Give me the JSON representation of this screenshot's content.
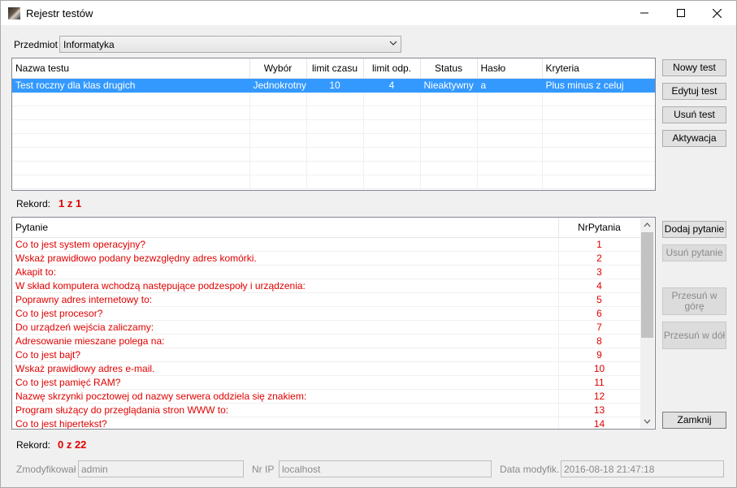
{
  "window": {
    "title": "Rejestr testów"
  },
  "subject": {
    "label": "Przedmiot",
    "value": "Informatyka"
  },
  "tests": {
    "headers": [
      "Nazwa testu",
      "Wybór",
      "limit czasu",
      "limit odp.",
      "Status",
      "Hasło",
      "Kryteria"
    ],
    "rows": [
      [
        "Test roczny dla klas drugich",
        "Jednokrotny",
        "10",
        "4",
        "Nieaktywny",
        "a",
        "Plus minus z celuj"
      ]
    ]
  },
  "test_buttons": {
    "new": "Nowy test",
    "edit": "Edytuj test",
    "delete": "Usuń test",
    "activate": "Aktywacja"
  },
  "record_tests": {
    "label": "Rekord:",
    "value": "1 z 1"
  },
  "questions": {
    "headers": [
      "Pytanie",
      "NrPytania"
    ],
    "rows": [
      [
        "Co to jest system operacyjny?",
        "1"
      ],
      [
        "Wskaż prawidłowo podany bezwzględny adres komórki.",
        "2"
      ],
      [
        "Akapit to:",
        "3"
      ],
      [
        "W skład komputera wchodzą następujące podzespoły i urządzenia:",
        "4"
      ],
      [
        "Poprawny adres internetowy to:",
        "5"
      ],
      [
        "Co to jest procesor?",
        "6"
      ],
      [
        "Do urządzeń wejścia zaliczamy:",
        "7"
      ],
      [
        "Adresowanie mieszane polega na:",
        "8"
      ],
      [
        "Co to jest bajt?",
        "9"
      ],
      [
        "Wskaż prawidłowy adres e-mail.",
        "10"
      ],
      [
        "Co to jest pamięć RAM?",
        "11"
      ],
      [
        "Nazwę skrzynki pocztowej od nazwy serwera oddziela się znakiem:",
        "12"
      ],
      [
        "Program służący do przeglądania stron WWW to:",
        "13"
      ],
      [
        "Co to jest hipertekst?",
        "14"
      ]
    ]
  },
  "question_buttons": {
    "add": "Dodaj pytanie",
    "delete": "Usuń pytanie",
    "up": "Przesuń w górę",
    "down": "Przesuń w dół",
    "close": "Zamknij"
  },
  "record_questions": {
    "label": "Rekord:",
    "value": "0 z 22"
  },
  "footer": {
    "modified_by_label": "Zmodyfikował",
    "modified_by": "admin",
    "ip_label": "Nr IP",
    "ip": "localhost",
    "date_label": "Data modyfik.",
    "date": "2016-08-18 21:47:18"
  }
}
